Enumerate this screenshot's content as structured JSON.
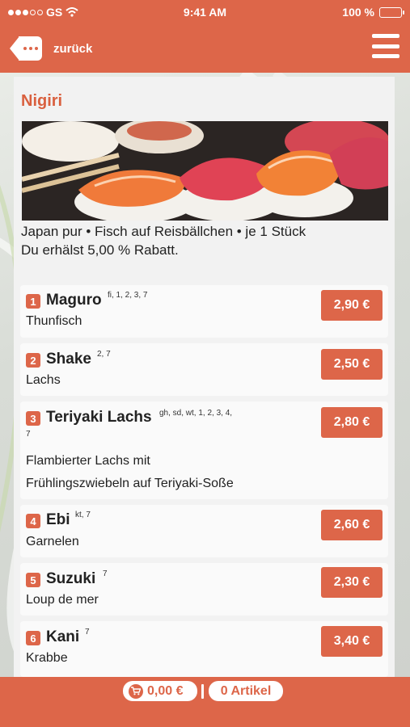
{
  "status_bar": {
    "carrier": "GS",
    "time": "9:41 AM",
    "battery": "100 %"
  },
  "nav": {
    "back_label": "zurück"
  },
  "category": {
    "title": "Nigiri",
    "description": "Japan pur • Fisch auf Reisbällchen • je 1 Stück",
    "discount": "Du erhälst 5,00 % Rabatt."
  },
  "items": [
    {
      "nr": "1",
      "name": "Maguro",
      "allergens": "fi, 1, 2, 3, 7",
      "description": "Thunfisch",
      "price": "2,90 €"
    },
    {
      "nr": "2",
      "name": "Shake",
      "allergens": "2, 7",
      "description": "Lachs",
      "price": "2,50 €"
    },
    {
      "nr": "3",
      "name": "Teriyaki Lachs",
      "allergens": "gh, sd, wt, 1, 2, 3, 4,",
      "allergens_cont": "7",
      "description": "Flambierter Lachs mit",
      "description_cont": "Frühlingszwiebeln auf Teriyaki-Soße",
      "price": "2,80 €"
    },
    {
      "nr": "4",
      "name": "Ebi",
      "allergens": "kt, 7",
      "description": "Garnelen",
      "price": "2,60 €"
    },
    {
      "nr": "5",
      "name": "Suzuki",
      "allergens": "7",
      "description": "Loup de mer",
      "price": "2,30 €"
    },
    {
      "nr": "6",
      "name": "Kani",
      "allergens": "7",
      "description": "Krabbe",
      "price": "3,40 €"
    }
  ],
  "footer": {
    "cart_total": "0,00 €",
    "article_count": "0 Artikel"
  },
  "colors": {
    "accent": "#dd6649",
    "title": "#d9603f",
    "panel": "#f2f2f2"
  }
}
